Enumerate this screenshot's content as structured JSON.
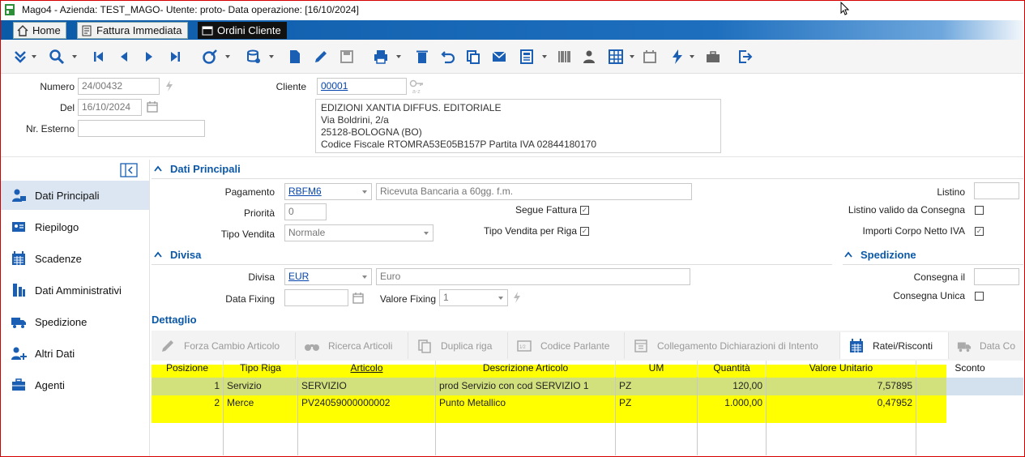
{
  "window": {
    "title": "Mago4 - Azienda: TEST_MAGO- Utente: proto- Data operazione: [16/10/2024]"
  },
  "tabs": [
    {
      "label": "Home",
      "icon": "home-icon"
    },
    {
      "label": "Fattura Immediata",
      "icon": "document-icon"
    },
    {
      "label": "Ordini Cliente",
      "icon": "window-icon"
    }
  ],
  "header": {
    "numero_label": "Numero",
    "numero_value": "24/00432",
    "del_label": "Del",
    "del_value": "16/10/2024",
    "nr_esterno_label": "Nr. Esterno",
    "nr_esterno_value": "",
    "cliente_label": "Cliente",
    "cliente_value": "00001",
    "address": [
      "EDIZIONI XANTIA DIFFUS. EDITORIALE",
      "Via Boldrini, 2/a",
      "25128-BOLOGNA (BO)",
      "Codice Fiscale RTOMRA53E05B157P Partita IVA 02844180170"
    ]
  },
  "sidebar": {
    "items": [
      {
        "label": "Dati Principali",
        "icon": "customer-icon",
        "active": true
      },
      {
        "label": "Riepilogo",
        "icon": "summary-icon"
      },
      {
        "label": "Scadenze",
        "icon": "calendar-icon"
      },
      {
        "label": "Dati Amministrativi",
        "icon": "admin-icon"
      },
      {
        "label": "Spedizione",
        "icon": "truck-icon"
      },
      {
        "label": "Altri Dati",
        "icon": "add-data-icon"
      },
      {
        "label": "Agenti",
        "icon": "briefcase-icon"
      }
    ]
  },
  "dati_principali": {
    "title": "Dati Principali",
    "pagamento_label": "Pagamento",
    "pagamento_code": "RBFM6",
    "pagamento_desc": "Ricevuta Bancaria a 60gg. f.m.",
    "priorita_label": "Priorità",
    "priorita_value": "0",
    "tipo_vendita_label": "Tipo Vendita",
    "tipo_vendita_value": "Normale",
    "segue_fattura_label": "Segue Fattura",
    "tipo_vendita_riga_label": "Tipo Vendita per Riga",
    "listino_label": "Listino",
    "listino_valido_label": "Listino valido da Consegna",
    "importi_label": "Importi Corpo Netto IVA"
  },
  "divisa": {
    "title": "Divisa",
    "divisa_label": "Divisa",
    "divisa_code": "EUR",
    "divisa_desc": "Euro",
    "data_fixing_label": "Data Fixing",
    "data_fixing_value": "",
    "valore_fixing_label": "Valore Fixing",
    "valore_fixing_value": "1"
  },
  "spedizione": {
    "title": "Spedizione",
    "consegna_il_label": "Consegna il",
    "consegna_unica_label": "Consegna Unica"
  },
  "dettaglio": {
    "title": "Dettaglio",
    "buttons": [
      "Forza Cambio Articolo",
      "Ricerca Articoli",
      "Duplica riga",
      "Codice Parlante",
      "Collegamento Dichiarazioni di Intento",
      "Ratei/Risconti",
      "Data Co"
    ],
    "columns": [
      "Posizione",
      "Tipo Riga",
      "Articolo",
      "Descrizione Articolo",
      "UM",
      "Quantità",
      "Valore Unitario",
      "Sconto"
    ],
    "rows": [
      {
        "pos": "1",
        "tipo": "Servizio",
        "articolo": "SERVIZIO",
        "descrizione": "prod Servizio con cod SERVIZIO 1",
        "um": "PZ",
        "quantita": "120,00",
        "valore": "7,57895"
      },
      {
        "pos": "2",
        "tipo": "Merce",
        "articolo": "PV24059000000002",
        "descrizione": "Punto Metallico",
        "um": "PZ",
        "quantita": "1.000,00",
        "valore": "0,47952"
      }
    ]
  },
  "colors": {
    "accent": "#0b58a8",
    "highlight": "#ffff00",
    "tab_band": "#0b5aa8"
  }
}
